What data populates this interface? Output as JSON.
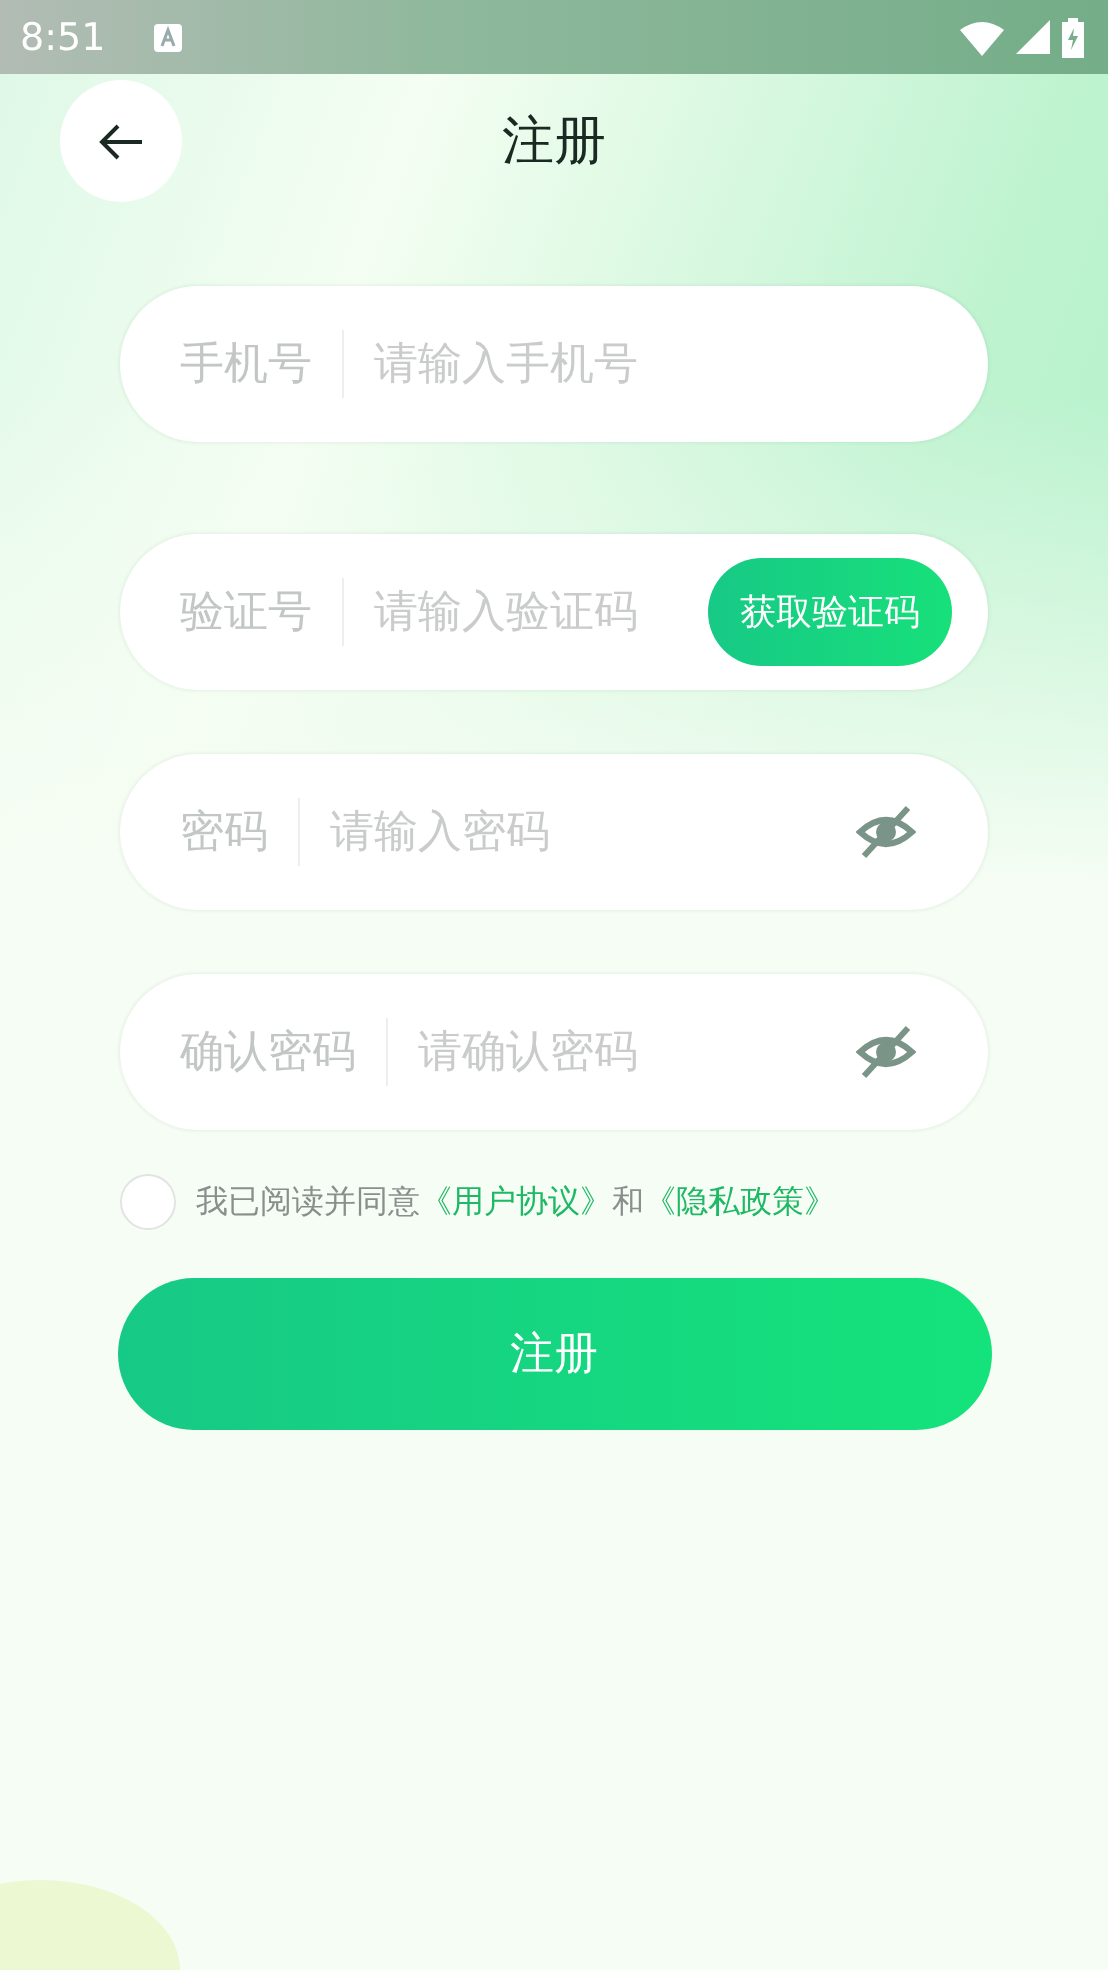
{
  "status_bar": {
    "time": "8:51"
  },
  "header": {
    "title": "注册"
  },
  "fields": [
    {
      "kind": "plain",
      "label": "手机号",
      "placeholder": "请输入手机号"
    },
    {
      "kind": "code",
      "label": "验证号",
      "placeholder": "请输入验证码",
      "button": "获取验证码"
    },
    {
      "kind": "password",
      "label": "密码",
      "placeholder": "请输入密码",
      "revealed": false
    },
    {
      "kind": "password",
      "label": "确认密码",
      "placeholder": "请确认密码",
      "revealed": false
    }
  ],
  "agreement": {
    "checked": false,
    "parts": [
      {
        "kind": "text",
        "text": "我已阅读并同意"
      },
      {
        "kind": "link",
        "text": "《用户协议》"
      },
      {
        "kind": "text",
        "text": "和"
      },
      {
        "kind": "link",
        "text": "《隐私政策》"
      }
    ]
  },
  "submit": "注册"
}
